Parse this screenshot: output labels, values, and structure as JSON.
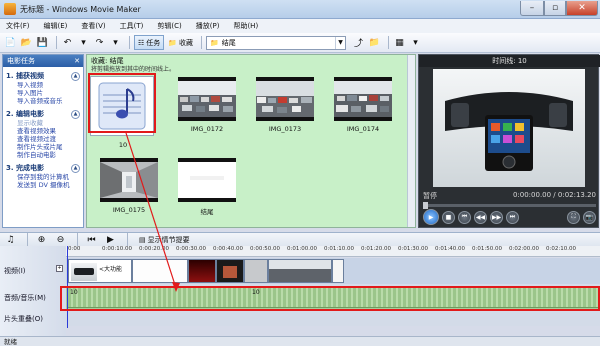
{
  "window": {
    "title": "无标题 - Windows Movie Maker",
    "icon": "movie-maker-icon"
  },
  "menu": [
    "文件(F)",
    "编辑(E)",
    "查看(V)",
    "工具(T)",
    "剪辑(C)",
    "播放(P)",
    "帮助(H)"
  ],
  "toolbar": {
    "tasks_label": "任务",
    "collections_label": "收藏",
    "collection_select_value": "结尾"
  },
  "task_pane": {
    "header": "电影任务",
    "sections": [
      {
        "title": "1. 捕获视频",
        "items": [
          "导入视频",
          "导入图片",
          "导入音频或音乐"
        ]
      },
      {
        "title": "2. 编辑电影",
        "items": [
          "显示收藏",
          "查看视频效果",
          "查看视频过渡",
          "制作片头或片尾",
          "制作自动电影"
        ]
      },
      {
        "title": "3. 完成电影",
        "items": [
          "保存到我的计算机",
          "发送到 DV 摄像机"
        ]
      }
    ]
  },
  "collection_area": {
    "title": "收藏: 结尾",
    "subtitle": "将剪辑拖放到其中的时间线上。",
    "clips": [
      {
        "name": "10",
        "kind": "music-note"
      },
      {
        "name": "IMG_0172",
        "kind": "parking"
      },
      {
        "name": "IMG_0173",
        "kind": "parking"
      },
      {
        "name": "IMG_0174",
        "kind": "parking"
      },
      {
        "name": "IMG_0175",
        "kind": "corridor"
      },
      {
        "name": "结尾",
        "kind": "white"
      }
    ]
  },
  "monitor": {
    "title": "时间线: 10",
    "status": "暂停",
    "time": "0:00:00.00 / 0:02:13.20"
  },
  "timeline": {
    "storyboard_label": "显示情节提要",
    "ruler_ticks": [
      "0:00",
      "0:00:10.00",
      "0:00:20.00",
      "0:00:30.00",
      "0:00:40.00",
      "0:00:50.00",
      "0:01:00.00",
      "0:01:10.00",
      "0:01:20.00",
      "0:01:30.00",
      "0:01:40.00",
      "0:01:50.00",
      "0:02:00.00",
      "0:02:10.00"
    ],
    "tracks": {
      "video": "视频(I)",
      "audio": "音频/音乐(M)",
      "overlay": "片头重叠(O)"
    },
    "video_clip_title": "<大功能",
    "audio_labels": [
      "10",
      "10"
    ]
  },
  "statusbar": {
    "text": "就绪"
  },
  "colors": {
    "highlight": "#e21a1a",
    "collection_bg": "#c8f0c8"
  }
}
